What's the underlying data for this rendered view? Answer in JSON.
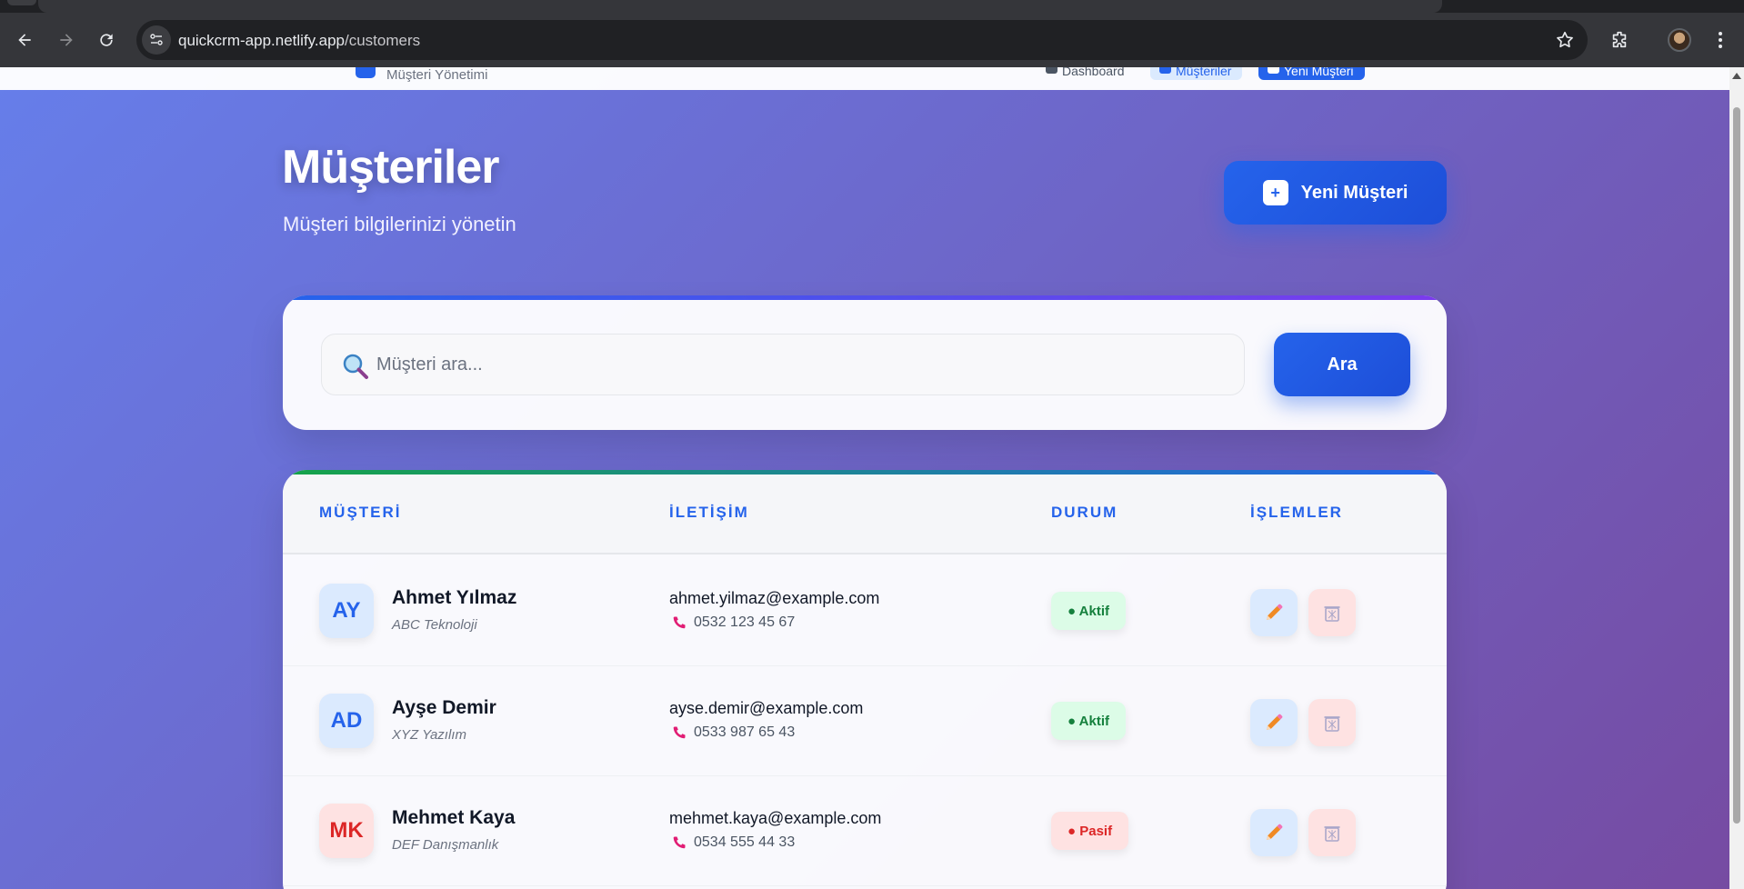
{
  "browser": {
    "url_host": "quickcrm-app.netlify.app",
    "url_path": "/customers"
  },
  "appnav": {
    "brand_subtitle": "Müşteri Yönetimi",
    "links": [
      "Dashboard",
      "Müşteriler",
      "Yeni Müşteri"
    ]
  },
  "header": {
    "title": "Müşteriler",
    "subtitle": "Müşteri bilgilerinizi yönetin",
    "new_button": "Yeni Müşteri"
  },
  "search": {
    "placeholder": "Müşteri ara...",
    "button": "Ara"
  },
  "table": {
    "columns": [
      "MÜŞTERİ",
      "İLETİŞİM",
      "DURUM",
      "İŞLEMLER"
    ],
    "rows": [
      {
        "initials": "AY",
        "name": "Ahmet Yılmaz",
        "company": "ABC Teknoloji",
        "email": "ahmet.yilmaz@example.com",
        "phone": "0532 123 45 67",
        "status": "● Aktif"
      },
      {
        "initials": "AD",
        "name": "Ayşe Demir",
        "company": "XYZ Yazılım",
        "email": "ayse.demir@example.com",
        "phone": "0533 987 65 43",
        "status": "● Aktif"
      },
      {
        "initials": "MK",
        "name": "Mehmet Kaya",
        "company": "DEF Danışmanlık",
        "email": "mehmet.kaya@example.com",
        "phone": "0534 555 44 33",
        "status": "● Pasif"
      }
    ]
  },
  "colors": {
    "accent": "#2563eb",
    "active": "#15803d",
    "inactive": "#dc2626",
    "bg_start": "#667eea",
    "bg_end": "#764ba2"
  }
}
